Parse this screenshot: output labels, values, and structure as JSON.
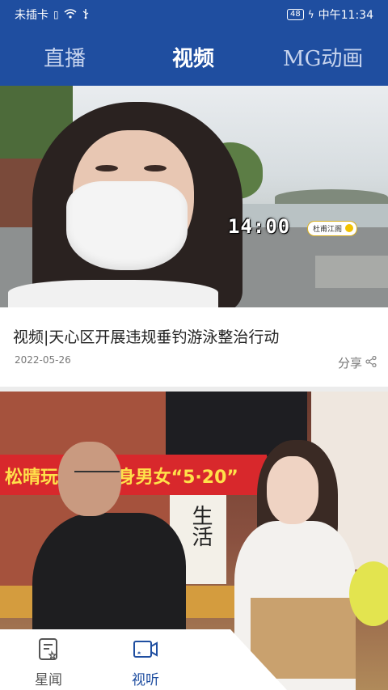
{
  "status_bar": {
    "carrier": "未插卡",
    "battery": "48",
    "time": "中午11:34",
    "icons": [
      "sim-missing-icon",
      "wifi-icon",
      "usb-icon",
      "battery-icon",
      "charging-icon"
    ]
  },
  "header": {
    "tabs": [
      {
        "label": "直播",
        "active": false
      },
      {
        "label": "视频",
        "active": true
      },
      {
        "label": "MG动画",
        "active": false
      }
    ],
    "background_color": "#1f4ea0"
  },
  "feed": [
    {
      "title": "视频|天心区开展违规垂钓游泳整治行动",
      "date": "2022-05-26",
      "share_label": "分享",
      "thumbnail_overlay": {
        "timecode": "14:00",
        "channel": "杜甫江阁"
      }
    },
    {
      "thumbnail_overlay": {
        "banner": "松晴玩 优质单身男女“5·20”",
        "poster": "生活"
      }
    }
  ],
  "bottom_nav": {
    "items": [
      {
        "label": "星闻",
        "icon": "news-doc-icon",
        "active": false
      },
      {
        "label": "视听",
        "icon": "video-camera-icon",
        "active": true
      }
    ],
    "active_color": "#1f4ea0"
  }
}
